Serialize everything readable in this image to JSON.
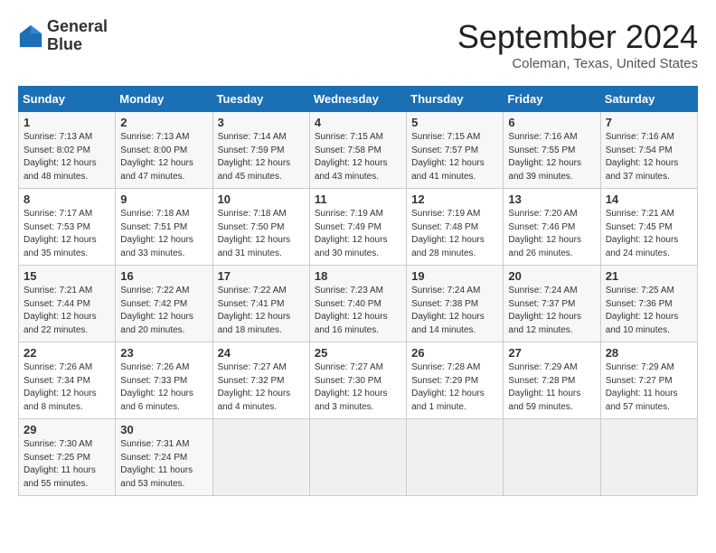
{
  "header": {
    "logo_line1": "General",
    "logo_line2": "Blue",
    "month": "September 2024",
    "location": "Coleman, Texas, United States"
  },
  "weekdays": [
    "Sunday",
    "Monday",
    "Tuesday",
    "Wednesday",
    "Thursday",
    "Friday",
    "Saturday"
  ],
  "weeks": [
    [
      {
        "day": "1",
        "sunrise": "7:13 AM",
        "sunset": "8:02 PM",
        "daylight": "12 hours and 48 minutes."
      },
      {
        "day": "2",
        "sunrise": "7:13 AM",
        "sunset": "8:00 PM",
        "daylight": "12 hours and 47 minutes."
      },
      {
        "day": "3",
        "sunrise": "7:14 AM",
        "sunset": "7:59 PM",
        "daylight": "12 hours and 45 minutes."
      },
      {
        "day": "4",
        "sunrise": "7:15 AM",
        "sunset": "7:58 PM",
        "daylight": "12 hours and 43 minutes."
      },
      {
        "day": "5",
        "sunrise": "7:15 AM",
        "sunset": "7:57 PM",
        "daylight": "12 hours and 41 minutes."
      },
      {
        "day": "6",
        "sunrise": "7:16 AM",
        "sunset": "7:55 PM",
        "daylight": "12 hours and 39 minutes."
      },
      {
        "day": "7",
        "sunrise": "7:16 AM",
        "sunset": "7:54 PM",
        "daylight": "12 hours and 37 minutes."
      }
    ],
    [
      {
        "day": "8",
        "sunrise": "7:17 AM",
        "sunset": "7:53 PM",
        "daylight": "12 hours and 35 minutes."
      },
      {
        "day": "9",
        "sunrise": "7:18 AM",
        "sunset": "7:51 PM",
        "daylight": "12 hours and 33 minutes."
      },
      {
        "day": "10",
        "sunrise": "7:18 AM",
        "sunset": "7:50 PM",
        "daylight": "12 hours and 31 minutes."
      },
      {
        "day": "11",
        "sunrise": "7:19 AM",
        "sunset": "7:49 PM",
        "daylight": "12 hours and 30 minutes."
      },
      {
        "day": "12",
        "sunrise": "7:19 AM",
        "sunset": "7:48 PM",
        "daylight": "12 hours and 28 minutes."
      },
      {
        "day": "13",
        "sunrise": "7:20 AM",
        "sunset": "7:46 PM",
        "daylight": "12 hours and 26 minutes."
      },
      {
        "day": "14",
        "sunrise": "7:21 AM",
        "sunset": "7:45 PM",
        "daylight": "12 hours and 24 minutes."
      }
    ],
    [
      {
        "day": "15",
        "sunrise": "7:21 AM",
        "sunset": "7:44 PM",
        "daylight": "12 hours and 22 minutes."
      },
      {
        "day": "16",
        "sunrise": "7:22 AM",
        "sunset": "7:42 PM",
        "daylight": "12 hours and 20 minutes."
      },
      {
        "day": "17",
        "sunrise": "7:22 AM",
        "sunset": "7:41 PM",
        "daylight": "12 hours and 18 minutes."
      },
      {
        "day": "18",
        "sunrise": "7:23 AM",
        "sunset": "7:40 PM",
        "daylight": "12 hours and 16 minutes."
      },
      {
        "day": "19",
        "sunrise": "7:24 AM",
        "sunset": "7:38 PM",
        "daylight": "12 hours and 14 minutes."
      },
      {
        "day": "20",
        "sunrise": "7:24 AM",
        "sunset": "7:37 PM",
        "daylight": "12 hours and 12 minutes."
      },
      {
        "day": "21",
        "sunrise": "7:25 AM",
        "sunset": "7:36 PM",
        "daylight": "12 hours and 10 minutes."
      }
    ],
    [
      {
        "day": "22",
        "sunrise": "7:26 AM",
        "sunset": "7:34 PM",
        "daylight": "12 hours and 8 minutes."
      },
      {
        "day": "23",
        "sunrise": "7:26 AM",
        "sunset": "7:33 PM",
        "daylight": "12 hours and 6 minutes."
      },
      {
        "day": "24",
        "sunrise": "7:27 AM",
        "sunset": "7:32 PM",
        "daylight": "12 hours and 4 minutes."
      },
      {
        "day": "25",
        "sunrise": "7:27 AM",
        "sunset": "7:30 PM",
        "daylight": "12 hours and 3 minutes."
      },
      {
        "day": "26",
        "sunrise": "7:28 AM",
        "sunset": "7:29 PM",
        "daylight": "12 hours and 1 minute."
      },
      {
        "day": "27",
        "sunrise": "7:29 AM",
        "sunset": "7:28 PM",
        "daylight": "11 hours and 59 minutes."
      },
      {
        "day": "28",
        "sunrise": "7:29 AM",
        "sunset": "7:27 PM",
        "daylight": "11 hours and 57 minutes."
      }
    ],
    [
      {
        "day": "29",
        "sunrise": "7:30 AM",
        "sunset": "7:25 PM",
        "daylight": "11 hours and 55 minutes."
      },
      {
        "day": "30",
        "sunrise": "7:31 AM",
        "sunset": "7:24 PM",
        "daylight": "11 hours and 53 minutes."
      },
      null,
      null,
      null,
      null,
      null
    ]
  ]
}
